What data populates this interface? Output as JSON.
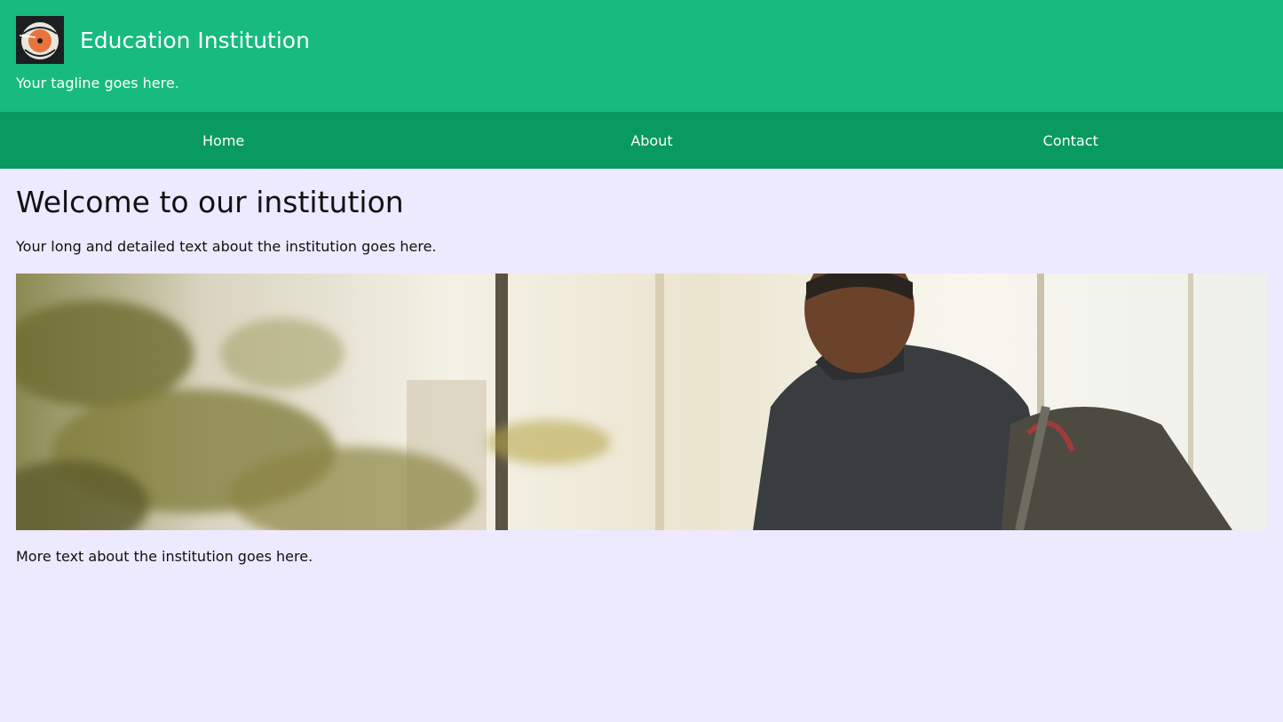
{
  "header": {
    "title": "Education Institution",
    "tagline": "Your tagline goes here.",
    "logo_icon": "record-badge-logo",
    "background_color": "#16bb7d"
  },
  "nav": {
    "background_color": "#089a5f",
    "items": [
      {
        "label": "Home"
      },
      {
        "label": "About"
      },
      {
        "label": "Contact"
      }
    ]
  },
  "main": {
    "heading": "Welcome to our institution",
    "intro": "Your long and detailed text about the institution goes here.",
    "hero_image": "photo of student with backpack by window with plant",
    "more_text": "More text about the institution goes here."
  },
  "page": {
    "background_color": "#ede9fe"
  }
}
